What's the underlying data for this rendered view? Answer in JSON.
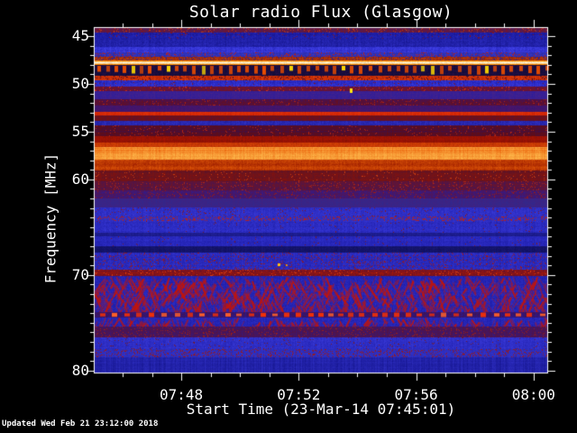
{
  "page": {
    "background": "#000000",
    "text_color": "#ffffff",
    "updated_note": "Updated Wed Feb 21 23:12:00 2018"
  },
  "chart_data": {
    "type": "heatmap",
    "title": "Solar radio Flux (Glasgow)",
    "xlabel": "Start Time (23-Mar-14 07:45:01)",
    "ylabel": "Frequency [MHz]",
    "y_axis_direction": "increasing-downward",
    "y_range_mhz": [
      44.06,
      80.3
    ],
    "x_range_minutes": [
      0,
      15.48
    ],
    "x_start_time": "07:45:01",
    "x_ticks": [
      {
        "label": "07:48",
        "minutes": 2.983
      },
      {
        "label": "07:52",
        "minutes": 6.983
      },
      {
        "label": "07:56",
        "minutes": 10.983
      },
      {
        "label": "08:00",
        "minutes": 14.983
      }
    ],
    "x_minor": {
      "start": 0.983,
      "step": 1,
      "count": 15
    },
    "y_ticks": [
      {
        "label": "45",
        "mhz": 45
      },
      {
        "label": "50",
        "mhz": 50
      },
      {
        "label": "55",
        "mhz": 55
      },
      {
        "label": "60",
        "mhz": 60
      },
      {
        "label": "70",
        "mhz": 70
      },
      {
        "label": "80",
        "mhz": 80
      }
    ],
    "y_minor": {
      "start": 45,
      "step": 1,
      "count": 36
    },
    "frame_color": "#ffffff",
    "palette_note": "blue background, red/orange interference bands, yellow-white carrier",
    "bands": [
      {
        "f0": 44.06,
        "f1": 44.62,
        "style": "mottle",
        "c": [
          "#8c1010",
          "#3a2070"
        ],
        "sp": [
          "#c83c10",
          0.1
        ]
      },
      {
        "f0": 44.62,
        "f1": 45.28,
        "style": "mottle",
        "c": [
          "#12128a",
          "#2a2ac0"
        ],
        "sp": [
          "#8c1414",
          0.04
        ]
      },
      {
        "f0": 45.28,
        "f1": 46.13,
        "style": "mottle",
        "c": [
          "#14148c",
          "#2e2ec4"
        ]
      },
      {
        "f0": 46.13,
        "f1": 46.69,
        "style": "mottle",
        "c": [
          "#2222b8",
          "#4646ee"
        ]
      },
      {
        "f0": 46.69,
        "f1": 47.16,
        "style": "mottle",
        "c": [
          "#28289c",
          "#3a3ad0"
        ],
        "sp": [
          "#c02010",
          0.13
        ]
      },
      {
        "f0": 47.16,
        "f1": 47.54,
        "style": "mottle",
        "c": [
          "#c84408",
          "#83180a"
        ],
        "sp": [
          "#2020a0",
          0.15
        ]
      },
      {
        "f0": 47.54,
        "f1": 48.01,
        "style": "bright",
        "c": [
          "#ff8800",
          "#fffbe0"
        ]
      },
      {
        "f0": 48.01,
        "f1": 49.14,
        "style": "dash",
        "c": [
          "#0b0b34",
          "#2a1048"
        ],
        "dash": "#e84c00",
        "bright": "#ffd800",
        "period": 10,
        "dw": 4
      },
      {
        "f0": 49.14,
        "f1": 49.61,
        "style": "mottle",
        "c": [
          "#a81800",
          "#e8440a"
        ],
        "sp": [
          "#400c28",
          0.12
        ]
      },
      {
        "f0": 49.61,
        "f1": 50.27,
        "style": "mottle",
        "c": [
          "#1c1caa",
          "#4040e8"
        ],
        "sp": [
          "#8c1414",
          0.04
        ]
      },
      {
        "f0": 50.27,
        "f1": 50.74,
        "style": "mottle",
        "c": [
          "#901408",
          "#45125e"
        ],
        "sp": [
          "#d83010",
          0.08
        ]
      },
      {
        "f0": 50.74,
        "f1": 51.59,
        "style": "mottle",
        "c": [
          "#2a1c9c",
          "#4a2488"
        ]
      },
      {
        "f0": 51.59,
        "f1": 52.24,
        "style": "mottle",
        "c": [
          "#6e0e14",
          "#3c1264"
        ],
        "sp": [
          "#b42410",
          0.06
        ]
      },
      {
        "f0": 52.24,
        "f1": 52.9,
        "style": "mottle",
        "c": [
          "#321670",
          "#521468"
        ]
      },
      {
        "f0": 52.9,
        "f1": 53.28,
        "style": "mottle",
        "c": [
          "#c81e04",
          "#e83808"
        ],
        "wr": 0.3
      },
      {
        "f0": 53.28,
        "f1": 53.84,
        "style": "mottle",
        "c": [
          "#7c1008",
          "#52103c"
        ]
      },
      {
        "f0": 53.84,
        "f1": 54.31,
        "style": "mottle",
        "c": [
          "#1b1b96",
          "#3434cc"
        ]
      },
      {
        "f0": 54.31,
        "f1": 55.44,
        "style": "mottle",
        "c": [
          "#6c0c08",
          "#381050"
        ],
        "wy": 0.45,
        "wr": 0.35,
        "sp": [
          "#c02810",
          0.05
        ]
      },
      {
        "f0": 55.44,
        "f1": 56.1,
        "style": "mottle",
        "c": [
          "#b01404",
          "#7c1004"
        ],
        "wy": 0.35
      },
      {
        "f0": 56.1,
        "f1": 56.57,
        "style": "mottle",
        "c": [
          "#e04c04",
          "#b02804"
        ]
      },
      {
        "f0": 56.57,
        "f1": 57.89,
        "style": "mottle",
        "c": [
          "#e85a06",
          "#ffbe50"
        ],
        "wy": 0.5,
        "wr": 0.25
      },
      {
        "f0": 57.89,
        "f1": 59.11,
        "style": "mottle",
        "c": [
          "#e05808",
          "#9c1c00"
        ],
        "wy": 0.45
      },
      {
        "f0": 59.11,
        "f1": 60.24,
        "style": "mottle",
        "c": [
          "#8c1208",
          "#55142c"
        ],
        "wy": 0.4,
        "sp": [
          "#d04010",
          0.04
        ]
      },
      {
        "f0": 60.24,
        "f1": 61.18,
        "style": "mottle",
        "c": [
          "#78141c",
          "#3c1460"
        ],
        "sp": [
          "#b42814",
          0.08
        ]
      },
      {
        "f0": 61.18,
        "f1": 62.03,
        "style": "mottle",
        "c": [
          "#5a1448",
          "#2c1c94"
        ],
        "sp": [
          "#a01c10",
          0.08
        ]
      },
      {
        "f0": 62.03,
        "f1": 62.97,
        "style": "mottle",
        "c": [
          "#30288e",
          "#45207c"
        ]
      },
      {
        "f0": 62.97,
        "f1": 63.91,
        "style": "mottle",
        "c": [
          "#2222b0",
          "#3a3ad8"
        ],
        "sp": [
          "#8c1818",
          0.05
        ]
      },
      {
        "f0": 63.91,
        "f1": 64.38,
        "style": "mottle",
        "c": [
          "#2828b4",
          "#3636cc"
        ],
        "sp": [
          "#c02010",
          0.22
        ]
      },
      {
        "f0": 64.38,
        "f1": 65.6,
        "style": "mottle",
        "c": [
          "#2020aa",
          "#3838da"
        ],
        "sp": [
          "#801818",
          0.02
        ]
      },
      {
        "f0": 65.6,
        "f1": 65.98,
        "style": "mottle",
        "c": [
          "#15157e",
          "#24249c"
        ]
      },
      {
        "f0": 65.98,
        "f1": 67.01,
        "style": "mottle",
        "c": [
          "#1e1ea8",
          "#3232d0"
        ],
        "sp": [
          "#801818",
          0.02
        ]
      },
      {
        "f0": 67.01,
        "f1": 67.67,
        "style": "mottle",
        "c": [
          "#0d0d5a",
          "#1a1a78"
        ]
      },
      {
        "f0": 67.67,
        "f1": 69.46,
        "style": "mottle",
        "c": [
          "#1e1ea4",
          "#3636d4"
        ],
        "sp": [
          "#a01814",
          0.1
        ]
      },
      {
        "f0": 69.46,
        "f1": 70.12,
        "style": "mottle",
        "c": [
          "#a81808",
          "#5c102c"
        ],
        "sp": [
          "#e04010",
          0.08
        ]
      },
      {
        "f0": 70.12,
        "f1": 73.88,
        "style": "diag",
        "c": [
          "#1a1aa2",
          "#3030c8"
        ],
        "streak": "#c81404",
        "streaks": 950
      },
      {
        "f0": 73.88,
        "f1": 74.45,
        "style": "dashrow",
        "c": [
          "#47123e",
          "#28189c"
        ],
        "dash": "#f03008",
        "bright": "#ff6028",
        "period": 13,
        "dw": 6
      },
      {
        "f0": 74.45,
        "f1": 75.39,
        "style": "diag",
        "c": [
          "#1a1aa2",
          "#3030c8"
        ],
        "streak": "#c81404",
        "streaks": 260
      },
      {
        "f0": 75.39,
        "f1": 76.52,
        "style": "mottle",
        "c": [
          "#5c1238",
          "#35187c"
        ],
        "sp": [
          "#a02014",
          0.09
        ]
      },
      {
        "f0": 76.52,
        "f1": 77.74,
        "style": "mottle",
        "c": [
          "#2222b0",
          "#3b3bdc"
        ],
        "sp": [
          "#801818",
          0.03
        ]
      },
      {
        "f0": 77.74,
        "f1": 78.59,
        "style": "mottle",
        "c": [
          "#2828b0",
          "#3434cc"
        ],
        "sp": [
          "#a01810",
          0.17
        ]
      },
      {
        "f0": 78.59,
        "f1": 80.3,
        "style": "mottle",
        "c": [
          "#161690",
          "#2e2ec2"
        ],
        "wc": 0.5,
        "wr": 0.3
      }
    ],
    "spots": [
      {
        "x_frac": 0.563,
        "mhz": 50.45,
        "w": 3,
        "h": 5,
        "color": "#ffe810"
      },
      {
        "x_frac": 0.405,
        "mhz": 68.8,
        "w": 3,
        "h": 3,
        "color": "#ffc010"
      },
      {
        "x_frac": 0.422,
        "mhz": 68.85,
        "w": 2,
        "h": 2,
        "color": "#e09010"
      }
    ]
  }
}
